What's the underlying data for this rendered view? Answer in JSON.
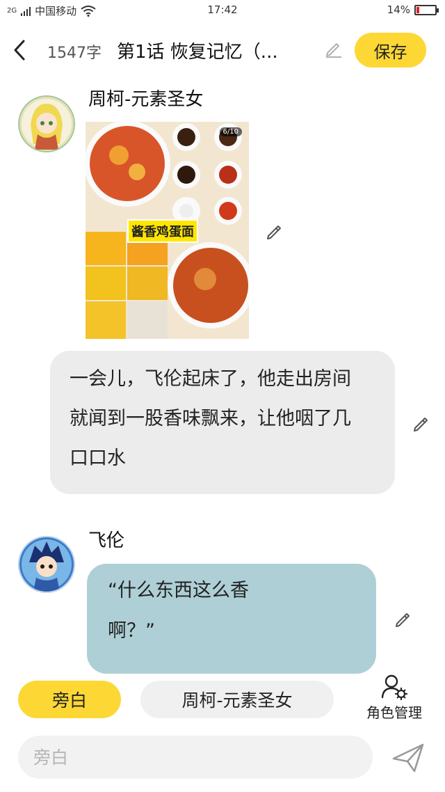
{
  "status_bar": {
    "network": "2G",
    "carrier": "中国移动",
    "time": "17:42",
    "battery": "14%",
    "battery_level": 0.14
  },
  "header": {
    "word_count": "1547字",
    "chapter_title": "第1话  恢复记忆（...",
    "save_label": "保存"
  },
  "messages": [
    {
      "speaker": "周柯-元素圣女",
      "image": {
        "label": "酱香鸡蛋面",
        "badge": "6/10"
      }
    },
    {
      "type": "narration",
      "text": "一会儿，飞伦起床了，他走出房间\n就闻到一股香味飘来，让他咽了几\n口口水"
    },
    {
      "speaker": "飞伦",
      "text": "“什么东西这么香\n啊？”"
    }
  ],
  "role_bar": {
    "narration_label": "旁白",
    "character_label": "周柯-元素圣女",
    "manage_label": "角色管理"
  },
  "input": {
    "placeholder": "旁白"
  },
  "colors": {
    "accent_yellow": "#fdd835",
    "narration_bubble": "#ececec",
    "character_bubble": "#aecfd6"
  }
}
